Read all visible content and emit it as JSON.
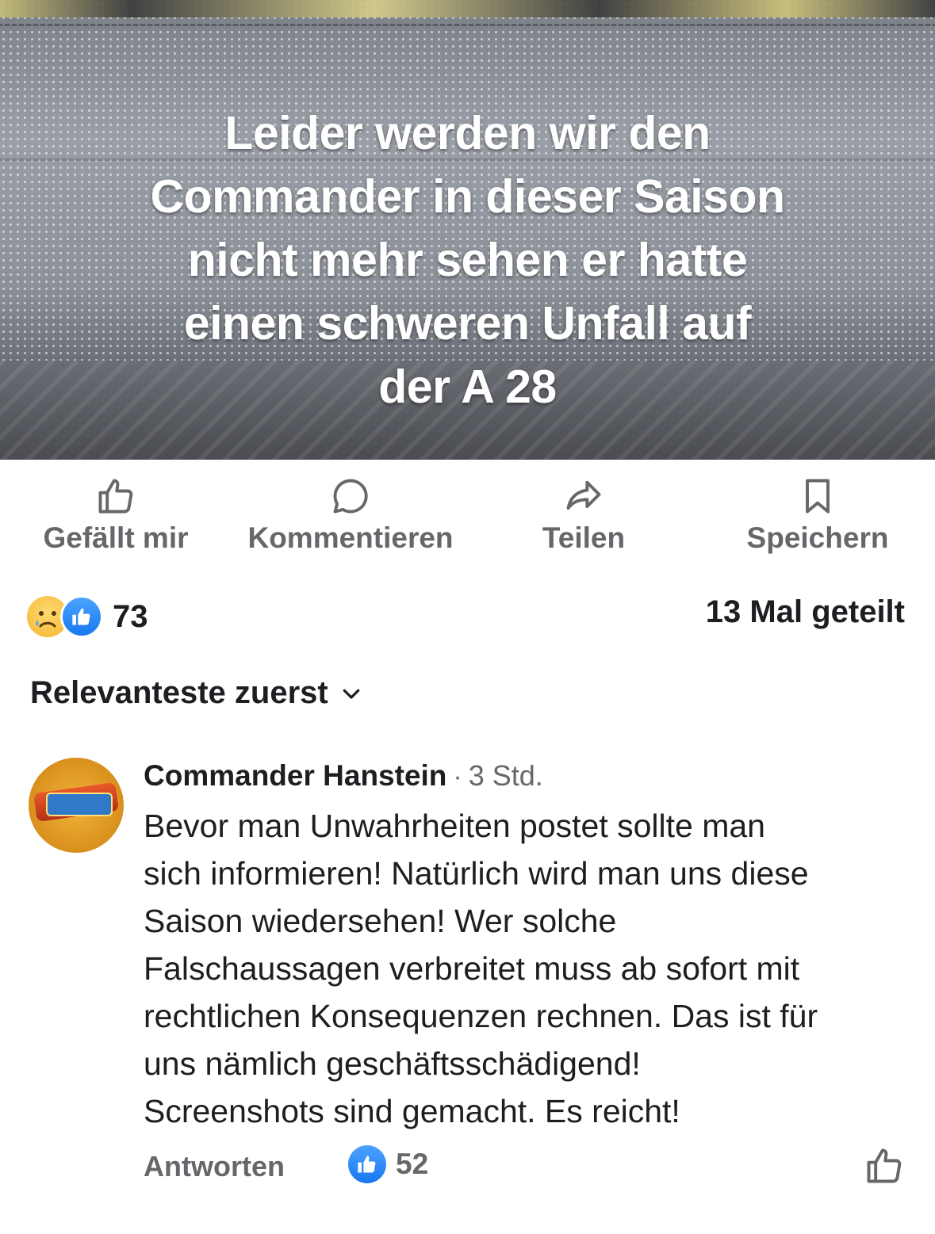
{
  "post": {
    "image_text": "Leider werden wir den\nCommander in dieser Saison\nnicht mehr sehen er hatte\neinen schweren Unfall auf\nder A 28"
  },
  "actions": {
    "like": {
      "label": "Gefällt mir",
      "icon": "thumbs-up-icon"
    },
    "comment": {
      "label": "Kommentieren",
      "icon": "comment-bubble-icon"
    },
    "share": {
      "label": "Teilen",
      "icon": "share-arrow-icon"
    },
    "save": {
      "label": "Speichern",
      "icon": "bookmark-icon"
    }
  },
  "reactions": {
    "icons": [
      "sad-reaction-icon",
      "like-reaction-icon"
    ],
    "count": "73",
    "shares": "13 Mal geteilt"
  },
  "sort": {
    "label": "Relevanteste zuerst",
    "icon": "chevron-down-icon"
  },
  "comment": {
    "author": "Commander Hanstein",
    "separator": "·",
    "time": "3 Std.",
    "text": "Bevor man Unwahrheiten postet sollte man\nsich informieren! Natürlich wird man uns diese\nSaison wiedersehen! Wer solche\nFalschaussagen verbreitet muss ab sofort mit\nrechtlichen Konsequenzen rechnen. Das ist für\nuns nämlich geschäftsschädigend!\nScreenshots sind gemacht. Es reicht!",
    "reply_label": "Antworten",
    "like_count": "52"
  },
  "colors": {
    "accent": "#1877f2",
    "secondary_text": "#65676b",
    "primary_text": "#1c1e21"
  }
}
